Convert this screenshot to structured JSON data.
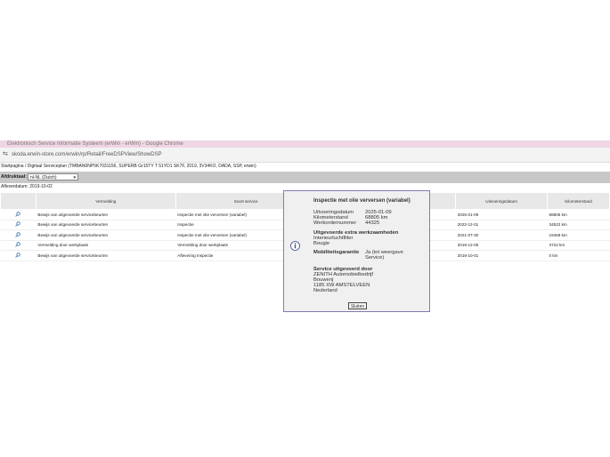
{
  "window": {
    "title": "Elektronisch Service Informatie Systeem (erWin - erWin) - Google Chrome"
  },
  "browser": {
    "url": "skoda.erwin-store.com/erwin/rp/Retail/FreeDSPView/ShowDSP"
  },
  "breadcrumb": "Startpagina / Digitaal Serviceplan (TMBAN0NP5K7031156, SUPERB Gr15TY T 51YD1 SK7F, 2019, 3V34KO, DADA, SSP, erwin)",
  "language": {
    "label": "Afdruktaal:",
    "selected": "nl-NL (Dutch)"
  },
  "delivery": "Afleverdatum: 2019-10-02",
  "table": {
    "headers": [
      "Vermelding",
      "Soort service",
      "",
      "Uitvoeringsdatum",
      "Kilometerstand"
    ],
    "rows": [
      {
        "vermelding": "Bewijs van uitgevoerde servicebeurten",
        "soort": "Inspectie met olie verversen (variabel)",
        "datum": "2025-01-09",
        "km": "68805 km"
      },
      {
        "vermelding": "Bewijs van uitgevoerde servicebeurten",
        "soort": "Inspectie",
        "datum": "2022-12-01",
        "km": "34522 km"
      },
      {
        "vermelding": "Bewijs van uitgevoerde servicebeurten",
        "soort": "Inspectie met olie verversen (variabel)",
        "datum": "2021-07-30",
        "km": "19469 km"
      },
      {
        "vermelding": "Vermelding door werkplaats",
        "soort": "Vermelding door werkplaats",
        "datum": "2019-12-05",
        "km": "3722 km"
      },
      {
        "vermelding": "Bewijs van uitgevoerde servicebeurten",
        "soort": "Aflevering Inspectie",
        "datum": "2019-10-01",
        "km": "0 km"
      }
    ]
  },
  "dialog": {
    "title": "Inspectie met olie verversen (variabel)",
    "fields": [
      {
        "k": "Uitvoeringsdatum",
        "v": "2025-01-09"
      },
      {
        "k": "Kilometerstand",
        "v": "68805 km"
      },
      {
        "k": "Werkordernummer",
        "v": "44325"
      }
    ],
    "extra_title": "Uitgevoerde extra werkzaamheden",
    "extra_items": [
      "Interieurluchtfilter",
      "Bougie"
    ],
    "mob_label": "Mobiliteitsgarantie",
    "mob_value": "Ja (tot weergave Service)",
    "service_title": "Service uitgevoerd door",
    "service_lines": [
      "ZENITH Automobielbedrijf",
      "Bouwerij",
      "1185 XW AMSTELVEEN",
      "Nederland"
    ],
    "close": "Sluiten"
  }
}
